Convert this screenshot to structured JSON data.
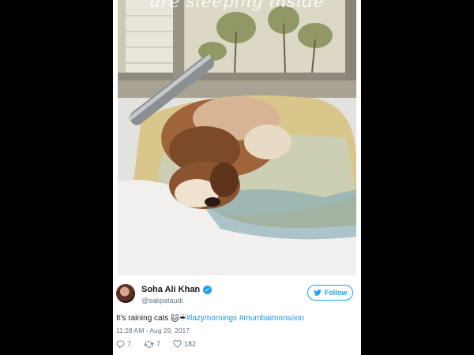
{
  "photo": {
    "overlay_text": "are sleeping inside",
    "description_icon": "dog-sleeping-on-blanket-photo"
  },
  "author": {
    "name": "Soha Ali Khan",
    "handle": "@sakpataudi",
    "verified": true
  },
  "follow_button": {
    "label": "Follow"
  },
  "tweet": {
    "text_prefix": "It's raining cats",
    "emoji_1": "🐱",
    "emoji_2": "☔",
    "hashtag_1": "#lazymornings",
    "hashtag_2": "#mumbaimonsoon"
  },
  "timestamp": "11:28 AM - Aug 29, 2017",
  "actions": {
    "replies": "7",
    "retweets": "7",
    "likes": "182"
  },
  "colors": {
    "accent": "#1da1f2",
    "link": "#1b95e0",
    "muted": "#657786",
    "text": "#14171a"
  }
}
